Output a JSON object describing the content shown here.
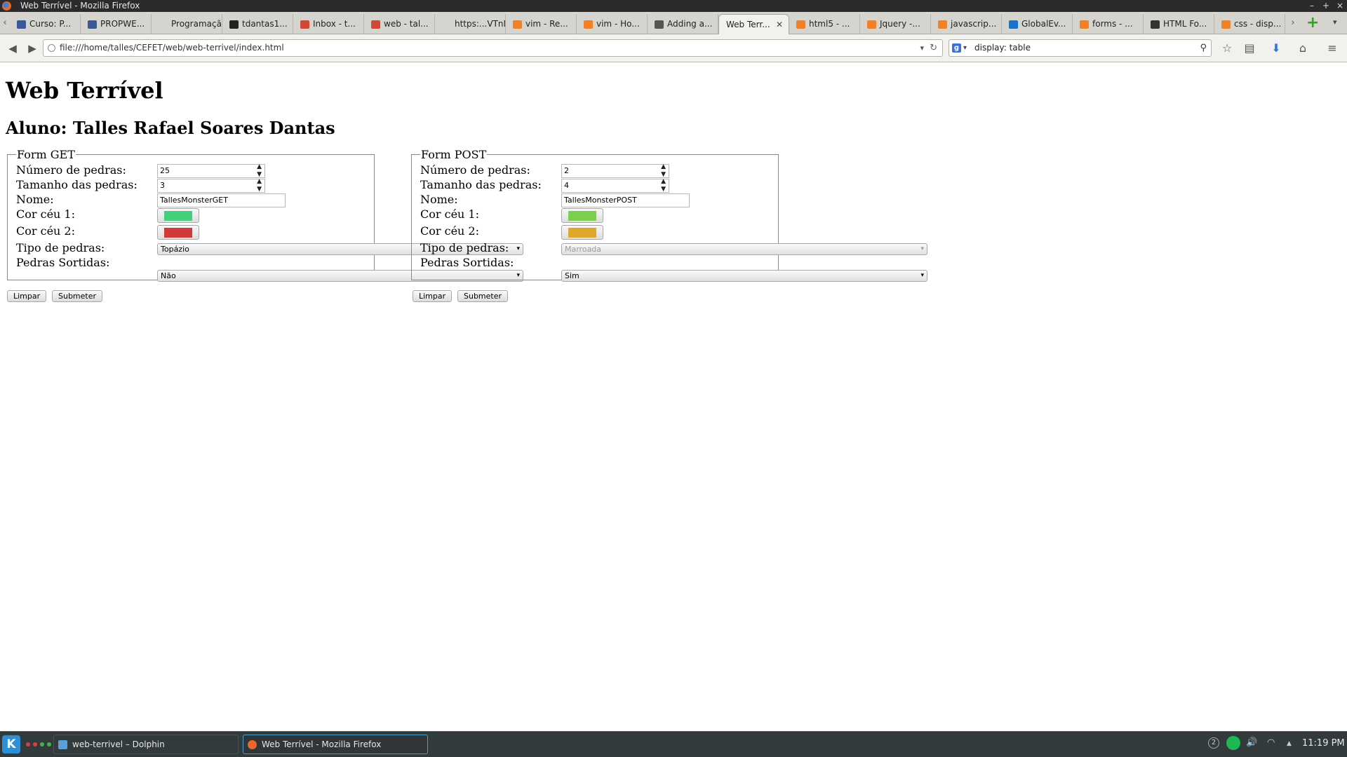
{
  "window": {
    "title": "Web Terrível - Mozilla Firefox",
    "controls": [
      "–",
      "+",
      "×"
    ]
  },
  "tabs": [
    {
      "label": "Curso: P...",
      "icon": "moodle-icon",
      "color": "#3b5998"
    },
    {
      "label": "PROPWE...",
      "icon": "moodle-icon",
      "color": "#3b5998"
    },
    {
      "label": "Programaçã...",
      "icon": "",
      "color": ""
    },
    {
      "label": "tdantas1...",
      "icon": "github-icon",
      "color": "#222222"
    },
    {
      "label": "Inbox - t...",
      "icon": "gmail-icon",
      "color": "#d14836"
    },
    {
      "label": "web - tal...",
      "icon": "gmail-icon",
      "color": "#d14836"
    },
    {
      "label": "https:...VTnN4",
      "icon": "",
      "color": ""
    },
    {
      "label": "vim - Re...",
      "icon": "stackexchange-icon",
      "color": "#f48024"
    },
    {
      "label": "vim - Ho...",
      "icon": "stackexchange-icon",
      "color": "#f48024"
    },
    {
      "label": "Adding a...",
      "icon": "gear-icon",
      "color": "#555555"
    },
    {
      "label": "Web Terr...",
      "icon": "",
      "color": "",
      "active": true
    },
    {
      "label": "html5 - ...",
      "icon": "stackexchange-icon",
      "color": "#f48024"
    },
    {
      "label": "Jquery -...",
      "icon": "stackexchange-icon",
      "color": "#f48024"
    },
    {
      "label": "javascrip...",
      "icon": "stackexchange-icon",
      "color": "#f48024"
    },
    {
      "label": "GlobalEv...",
      "icon": "globe-icon",
      "color": "#1a73c8"
    },
    {
      "label": "forms - ...",
      "icon": "stackexchange-icon",
      "color": "#f48024"
    },
    {
      "label": "HTML Fo...",
      "icon": "hg-icon",
      "color": "#333333"
    },
    {
      "label": "css - disp...",
      "icon": "stackexchange-icon",
      "color": "#f48024"
    }
  ],
  "nav": {
    "url": "file:///home/talles/CEFET/web/web-terrivel/index.html",
    "search_text": "display: table"
  },
  "page": {
    "title": "Web Terrível",
    "student": "Aluno: Talles Rafael Soares Dantas",
    "form_get": {
      "legend": "Form GET",
      "labels": {
        "num_pedras": "Número de pedras:",
        "tam_pedras": "Tamanho das pedras:",
        "nome": "Nome:",
        "cor1": "Cor céu 1:",
        "cor2": "Cor céu 2:",
        "tipo": "Tipo de pedras:",
        "sortidas": "Pedras Sortidas:"
      },
      "num_pedras": "25",
      "tam_pedras": "3",
      "nome": "TallesMonsterGET",
      "cor1": "#44d07a",
      "cor2": "#d03a3a",
      "tipo": "Topázio",
      "sortidas": "Não",
      "btn_limpar": "Limpar",
      "btn_submeter": "Submeter"
    },
    "form_post": {
      "legend": "Form POST",
      "labels": {
        "num_pedras": "Número de pedras:",
        "tam_pedras": "Tamanho das pedras:",
        "nome": "Nome:",
        "cor1": "Cor céu 1:",
        "cor2": "Cor céu 2:",
        "tipo": "Tipo de pedras:",
        "sortidas": "Pedras Sortidas:"
      },
      "num_pedras": "2",
      "tam_pedras": "4",
      "nome": "TallesMonsterPOST",
      "cor1": "#7ad04a",
      "cor2": "#e0a82a",
      "tipo": "Marroada",
      "tipo_disabled": true,
      "sortidas": "Sim",
      "btn_limpar": "Limpar",
      "btn_submeter": "Submeter"
    }
  },
  "taskbar": {
    "tasks": [
      {
        "label": "web-terrivel – Dolphin",
        "icon": "dolphin-icon"
      },
      {
        "label": "Web Terrível - Mozilla Firefox",
        "icon": "firefox-icon",
        "active": true
      }
    ],
    "badge": "2",
    "clock": "11:19 PM"
  }
}
